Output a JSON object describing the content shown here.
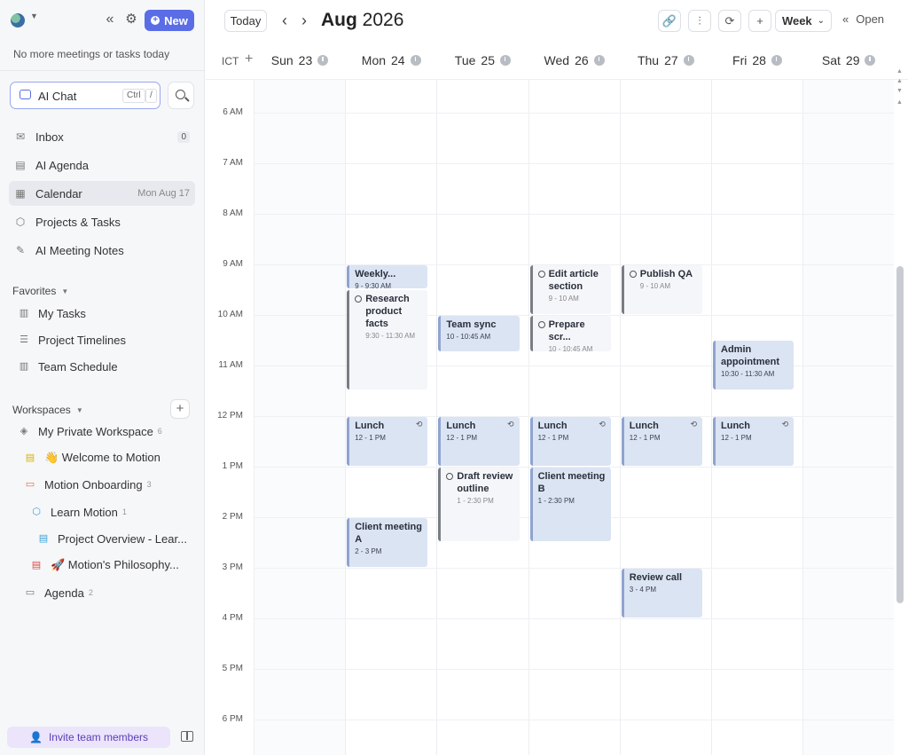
{
  "sidebar": {
    "new_label": "New",
    "status_text": "No more meetings or tasks today",
    "ai_chat": {
      "label": "AI Chat",
      "kbd1": "Ctrl",
      "kbd2": "/"
    },
    "nav": [
      {
        "label": "Inbox",
        "badge": "0",
        "icon": "inbox-icon"
      },
      {
        "label": "AI Agenda",
        "icon": "agenda-icon"
      },
      {
        "label": "Calendar",
        "date": "Mon Aug 17",
        "icon": "calendar-icon"
      },
      {
        "label": "Projects & Tasks",
        "icon": "cube-icon"
      },
      {
        "label": "AI Meeting Notes",
        "icon": "notes-icon"
      }
    ],
    "favorites_title": "Favorites",
    "favorites": [
      {
        "label": "My Tasks",
        "icon": "columns-icon"
      },
      {
        "label": "Project Timelines",
        "icon": "timeline-icon"
      },
      {
        "label": "Team Schedule",
        "icon": "columns-icon"
      }
    ],
    "workspaces_title": "Workspaces",
    "workspaces": [
      {
        "label": "My Private Workspace",
        "count": "6"
      },
      {
        "label": "👋 Welcome to Motion"
      },
      {
        "label": "Motion Onboarding",
        "count": "3"
      },
      {
        "label": "Learn Motion",
        "count": "1"
      },
      {
        "label": "Project Overview - Lear..."
      },
      {
        "label": "🚀 Motion's Philosophy..."
      },
      {
        "label": "Agenda",
        "count": "2"
      }
    ],
    "invite_label": "Invite team members"
  },
  "header": {
    "today_label": "Today",
    "month": "Aug",
    "year": "2026",
    "view_label": "Week",
    "open_label": "Open"
  },
  "timezone": "ICT",
  "days": [
    {
      "name": "Sun",
      "num": "23"
    },
    {
      "name": "Mon",
      "num": "24"
    },
    {
      "name": "Tue",
      "num": "25"
    },
    {
      "name": "Wed",
      "num": "26"
    },
    {
      "name": "Thu",
      "num": "27"
    },
    {
      "name": "Fri",
      "num": "28"
    },
    {
      "name": "Sat",
      "num": "29"
    }
  ],
  "hours": [
    "6 AM",
    "7 AM",
    "8 AM",
    "9 AM",
    "10 AM",
    "11 AM",
    "12 PM",
    "1 PM",
    "2 PM",
    "3 PM",
    "4 PM",
    "5 PM",
    "6 PM"
  ],
  "events": [
    {
      "day": 1,
      "start": 9.0,
      "end": 9.5,
      "title": "Weekly...",
      "time": "9 - 9:30 AM",
      "kind": "event"
    },
    {
      "day": 1,
      "start": 9.5,
      "end": 11.5,
      "title": "Research product facts",
      "time": "9:30 - 11:30 AM",
      "kind": "task"
    },
    {
      "day": 1,
      "start": 12.0,
      "end": 13.0,
      "title": "Lunch",
      "time": "12 - 1 PM",
      "kind": "event",
      "repeat": true
    },
    {
      "day": 1,
      "start": 14.0,
      "end": 15.0,
      "title": "Client meeting A",
      "time": "2 - 3 PM",
      "kind": "event"
    },
    {
      "day": 2,
      "start": 10.0,
      "end": 10.75,
      "title": "Team sync",
      "time": "10 - 10:45 AM",
      "kind": "event"
    },
    {
      "day": 2,
      "start": 12.0,
      "end": 13.0,
      "title": "Lunch",
      "time": "12 - 1 PM",
      "kind": "event",
      "repeat": true
    },
    {
      "day": 2,
      "start": 13.0,
      "end": 14.5,
      "title": "Draft review outline",
      "time": "1 - 2:30 PM",
      "kind": "task"
    },
    {
      "day": 3,
      "start": 9.0,
      "end": 10.0,
      "title": "Edit article section",
      "time": "9 - 10 AM",
      "kind": "task"
    },
    {
      "day": 3,
      "start": 10.0,
      "end": 10.75,
      "title": "Prepare scr...",
      "time": "10 - 10:45 AM",
      "kind": "task"
    },
    {
      "day": 3,
      "start": 12.0,
      "end": 13.0,
      "title": "Lunch",
      "time": "12 - 1 PM",
      "kind": "event",
      "repeat": true
    },
    {
      "day": 3,
      "start": 13.0,
      "end": 14.5,
      "title": "Client meeting B",
      "time": "1 - 2:30 PM",
      "kind": "event"
    },
    {
      "day": 4,
      "start": 9.0,
      "end": 10.0,
      "title": "Publish QA",
      "time": "9 - 10 AM",
      "kind": "task"
    },
    {
      "day": 4,
      "start": 12.0,
      "end": 13.0,
      "title": "Lunch",
      "time": "12 - 1 PM",
      "kind": "event",
      "repeat": true
    },
    {
      "day": 4,
      "start": 15.0,
      "end": 16.0,
      "title": "Review call",
      "time": "3 - 4 PM",
      "kind": "event"
    },
    {
      "day": 5,
      "start": 10.5,
      "end": 11.5,
      "title": "Admin appointment",
      "time": "10:30 - 11:30 AM",
      "kind": "event"
    },
    {
      "day": 5,
      "start": 12.0,
      "end": 13.0,
      "title": "Lunch",
      "time": "12 - 1 PM",
      "kind": "event",
      "repeat": true
    }
  ]
}
